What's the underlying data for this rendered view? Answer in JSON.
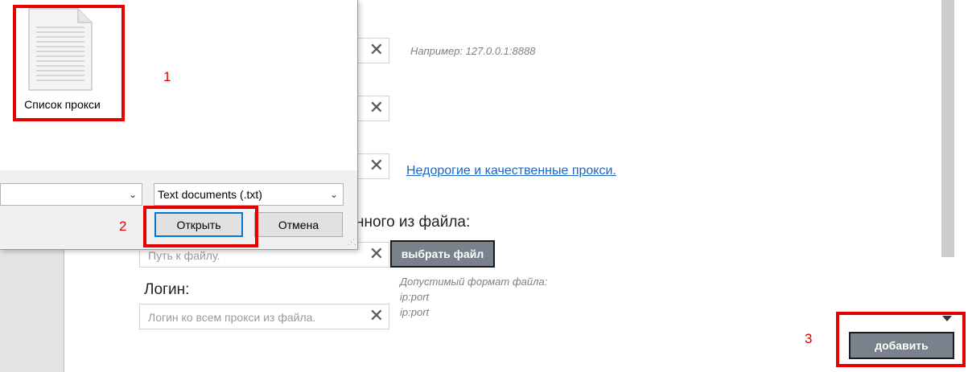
{
  "form": {
    "proxy_hint": "Например: 127.0.0.1:8888",
    "proxy_link": "Недорогие и качественные прокси.",
    "load_from_file_label": "нного из файла:",
    "file_path_placeholder": "Путь к файлу.",
    "choose_file_button": "выбрать файл",
    "format_hint": [
      "Допустимый формат файла:",
      "ip:port",
      "ip:port"
    ],
    "login_label": "Логин:",
    "login_placeholder": "Логин ко всем прокси из файла.",
    "add_button": "добавить",
    "clear_symbol": "✕"
  },
  "dialog": {
    "file_name": "Список прокси",
    "file_type_filter": "Text documents (.txt)",
    "file_name_input_value": "",
    "open_button": "Открыть",
    "cancel_button": "Отмена"
  },
  "annotations": {
    "marker_1": "1",
    "marker_2": "2",
    "marker_3": "3"
  },
  "colors": {
    "annotation_red": "#e60000",
    "dark_button": "#79818c",
    "link": "#1a66c6",
    "primary_focus": "#0078d7"
  }
}
